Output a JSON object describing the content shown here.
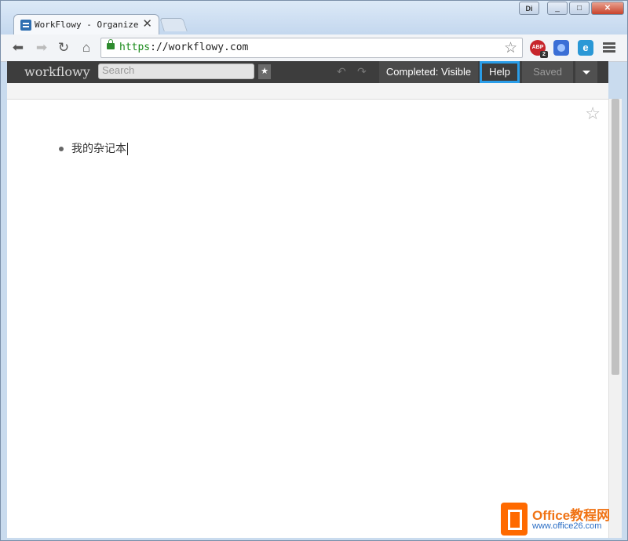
{
  "browser": {
    "tab_title": "WorkFlowy - Organize yo",
    "tab_close": "✕",
    "profile_label": "Di",
    "url_scheme": "https",
    "url_rest": "://workflowy.com",
    "extensions": {
      "abp_label": "ABP",
      "abp_badge": "2",
      "third_label": "e"
    }
  },
  "workflowy": {
    "logo": "workflowy",
    "search_placeholder": "Search",
    "completed_label": "Completed: Visible",
    "help_label": "Help",
    "saved_label": "Saved"
  },
  "page": {
    "items": [
      {
        "text": "我的杂记本"
      }
    ]
  },
  "watermark": {
    "title": "Office教程网",
    "url": "www.office26.com"
  },
  "colors": {
    "accent_highlight": "#2a9de8",
    "wf_bar": "#3d3d3d",
    "watermark_orange": "#f07314"
  }
}
